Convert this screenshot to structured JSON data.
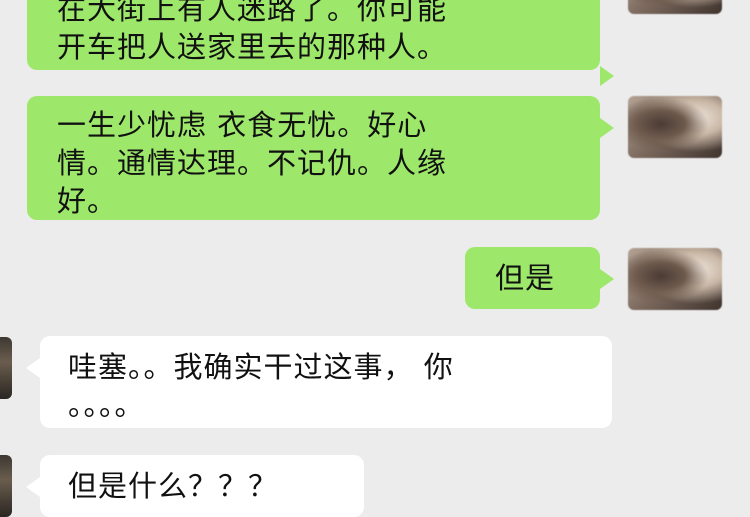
{
  "messages": [
    {
      "side": "out",
      "lines": [
        "在大街上有人迷路了。你可能",
        "开车把人送家里去的那种人。"
      ]
    },
    {
      "side": "out",
      "lines": [
        "一生少忧虑 衣食无忧。好心",
        "情。通情达理。不记仇。人缘",
        "好。"
      ]
    },
    {
      "side": "out",
      "lines": [
        "但是"
      ]
    },
    {
      "side": "in",
      "lines": [
        "哇塞。。我确实干过这事， 你",
        "。。。。"
      ]
    },
    {
      "side": "in",
      "lines": [
        "但是什么？？？"
      ]
    }
  ],
  "colors": {
    "background": "#ececec",
    "outgoing_bubble": "#9de86a",
    "incoming_bubble": "#ffffff",
    "text": "#111111"
  }
}
